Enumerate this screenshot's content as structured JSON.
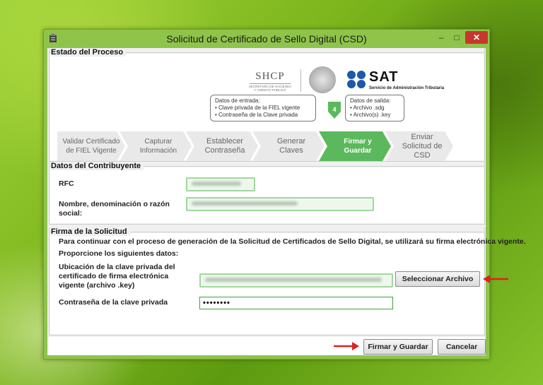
{
  "window": {
    "title": "Solicitud de Certificado de Sello Digital (CSD)",
    "controls": {
      "minimize": "–",
      "maximize": "□",
      "close": "✕"
    }
  },
  "logos": {
    "shcp": {
      "name": "SHCP",
      "sub1": "SECRETARÍA DE HACIENDA",
      "sub2": "Y CRÉDITO PÚBLICO"
    },
    "sat": {
      "name": "SAT",
      "sub": "Servicio de Administración Tributaria"
    },
    "colors": {
      "sat_blue": "#1d5aa6"
    }
  },
  "estado": {
    "label": "Estado del Proceso",
    "entrada": {
      "title": "Datos de entrada:",
      "items": [
        "• Clave privada de la FIEL vigente",
        "• Contraseña de la Clave privada"
      ]
    },
    "step_number": "4",
    "salida": {
      "title": "Datos de salida:",
      "items": [
        "• Archivo .sdg",
        "• Archivo(s) .key"
      ]
    },
    "steps": [
      {
        "line1": "Validar Certificado",
        "line2": "de FIEL Vigente",
        "line3": ""
      },
      {
        "line1": "Capturar",
        "line2": "Información",
        "line3": ""
      },
      {
        "line1": "Establecer",
        "line2": "Contraseña",
        "line3": ""
      },
      {
        "line1": "Generar",
        "line2": "Claves",
        "line3": ""
      },
      {
        "line1": "Firmar y",
        "line2": "Guardar",
        "line3": ""
      },
      {
        "line1": "Enviar",
        "line2": "Solicitud de",
        "line3": "CSD"
      }
    ],
    "active_step": 5,
    "colors": {
      "active": "#5cb85c",
      "inactive": "#e9e9e9"
    }
  },
  "contribuyente": {
    "label": "Datos del Contribuyente",
    "rfc_label": "RFC",
    "nombre_label_1": "Nombre, denominación o razón",
    "nombre_label_2": "social:"
  },
  "firma": {
    "label": "Firma de la Solicitud",
    "intro": "Para continuar con el proceso de generación de la Solicitud de Certificados de Sello Digital, se utilizará su firma electrónica vigente.",
    "prompt": "Proporcione los siguientes datos:",
    "ubicacion_label_1": "Ubicación de la clave privada del",
    "ubicacion_label_2": "certificado de firma electrónica",
    "ubicacion_label_3": "vigente (archivo .key)",
    "select_button": "Seleccionar Archivo",
    "password_label": "Contraseña de la clave privada",
    "password_value": "••••••••"
  },
  "footer": {
    "firmar_button": "Firmar y Guardar",
    "cancelar_button": "Cancelar"
  },
  "annotation": {
    "arrow_color": "#e02020"
  }
}
